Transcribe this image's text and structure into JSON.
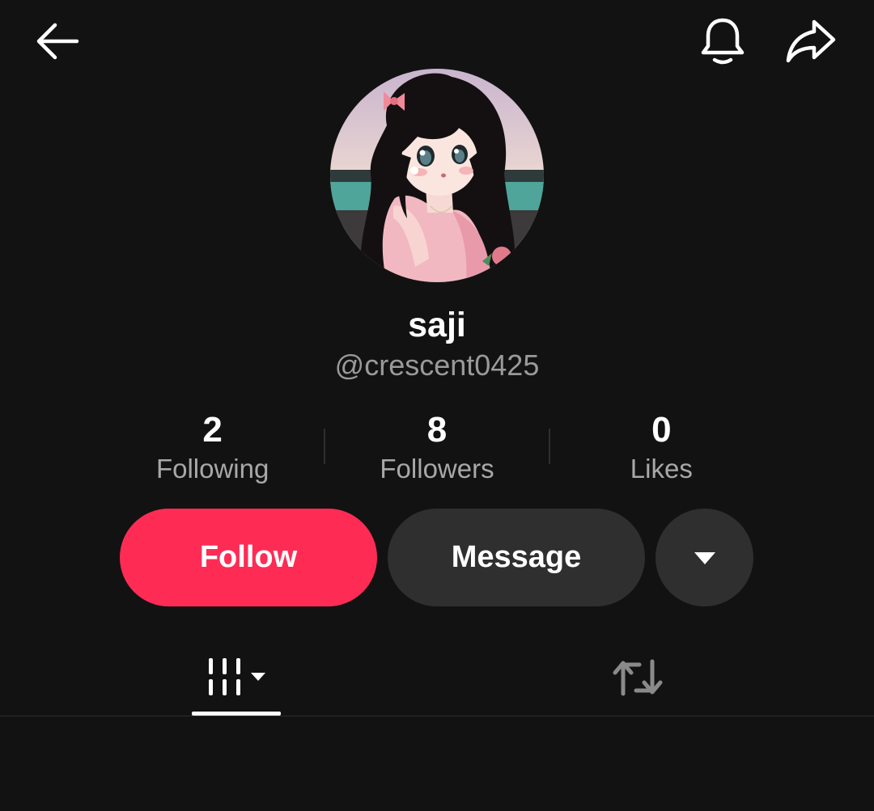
{
  "header": {
    "back_icon": "arrow-left-icon",
    "notification_icon": "bell-icon",
    "share_icon": "share-icon"
  },
  "profile": {
    "display_name": "saji",
    "username": "@crescent0425",
    "avatar_description": "anime-girl-avatar"
  },
  "stats": [
    {
      "value": "2",
      "label": "Following"
    },
    {
      "value": "8",
      "label": "Followers"
    },
    {
      "value": "0",
      "label": "Likes"
    }
  ],
  "actions": {
    "follow_label": "Follow",
    "message_label": "Message",
    "more_icon": "caret-down-icon"
  },
  "tabs": [
    {
      "name": "videos",
      "icon": "video-grid-icon",
      "has_dropdown": true,
      "selected": true
    },
    {
      "name": "reposts",
      "icon": "repost-icon",
      "selected": false
    }
  ],
  "colors": {
    "background": "#121212",
    "accent": "#fe2c55",
    "secondary_button": "#2f2f2f",
    "muted_text": "#9a9a9a"
  }
}
